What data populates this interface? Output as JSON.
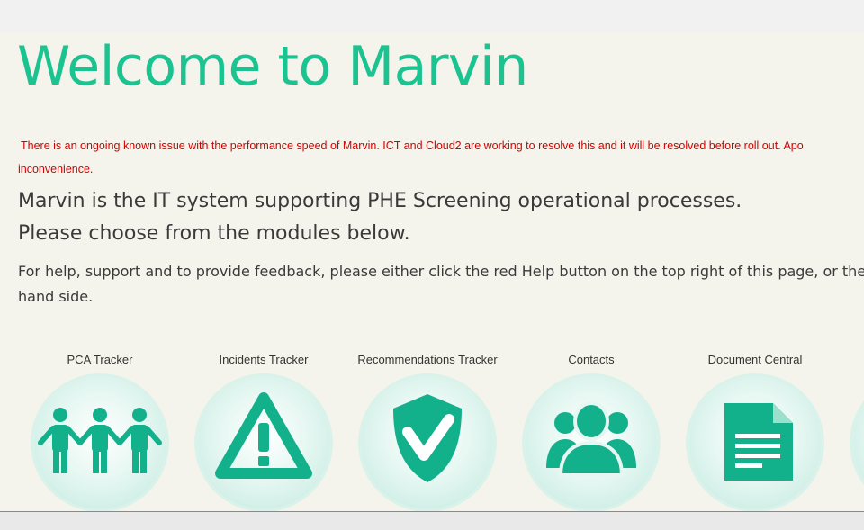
{
  "header": {
    "title": "Welcome to Marvin"
  },
  "notice": {
    "line1": "There is an ongoing known issue with the performance speed of Marvin. ICT and Cloud2 are working to resolve this and it will be resolved before roll out. Apo",
    "line2": "inconvenience."
  },
  "intro": {
    "line1": "Marvin is the IT system supporting PHE Screening operational processes.",
    "line2": "Please choose from the modules below."
  },
  "help": {
    "line1": "For help, support and to provide feedback, please either click the red Help button on the top right of this page, or the Help",
    "line2": "hand side."
  },
  "modules": [
    {
      "label": "PCA Tracker",
      "icon": "people-group-icon"
    },
    {
      "label": "Incidents Tracker",
      "icon": "warning-triangle-icon"
    },
    {
      "label": "Recommendations Tracker",
      "icon": "shield-check-icon"
    },
    {
      "label": "Contacts",
      "icon": "contacts-people-icon"
    },
    {
      "label": "Document Central",
      "icon": "document-icon"
    },
    {
      "label": "",
      "icon": "partial-module-icon"
    }
  ],
  "colors": {
    "accent": "#1ac38f",
    "icon": "#13b08c",
    "notice": "#d40000",
    "background": "#f5f4ec"
  }
}
